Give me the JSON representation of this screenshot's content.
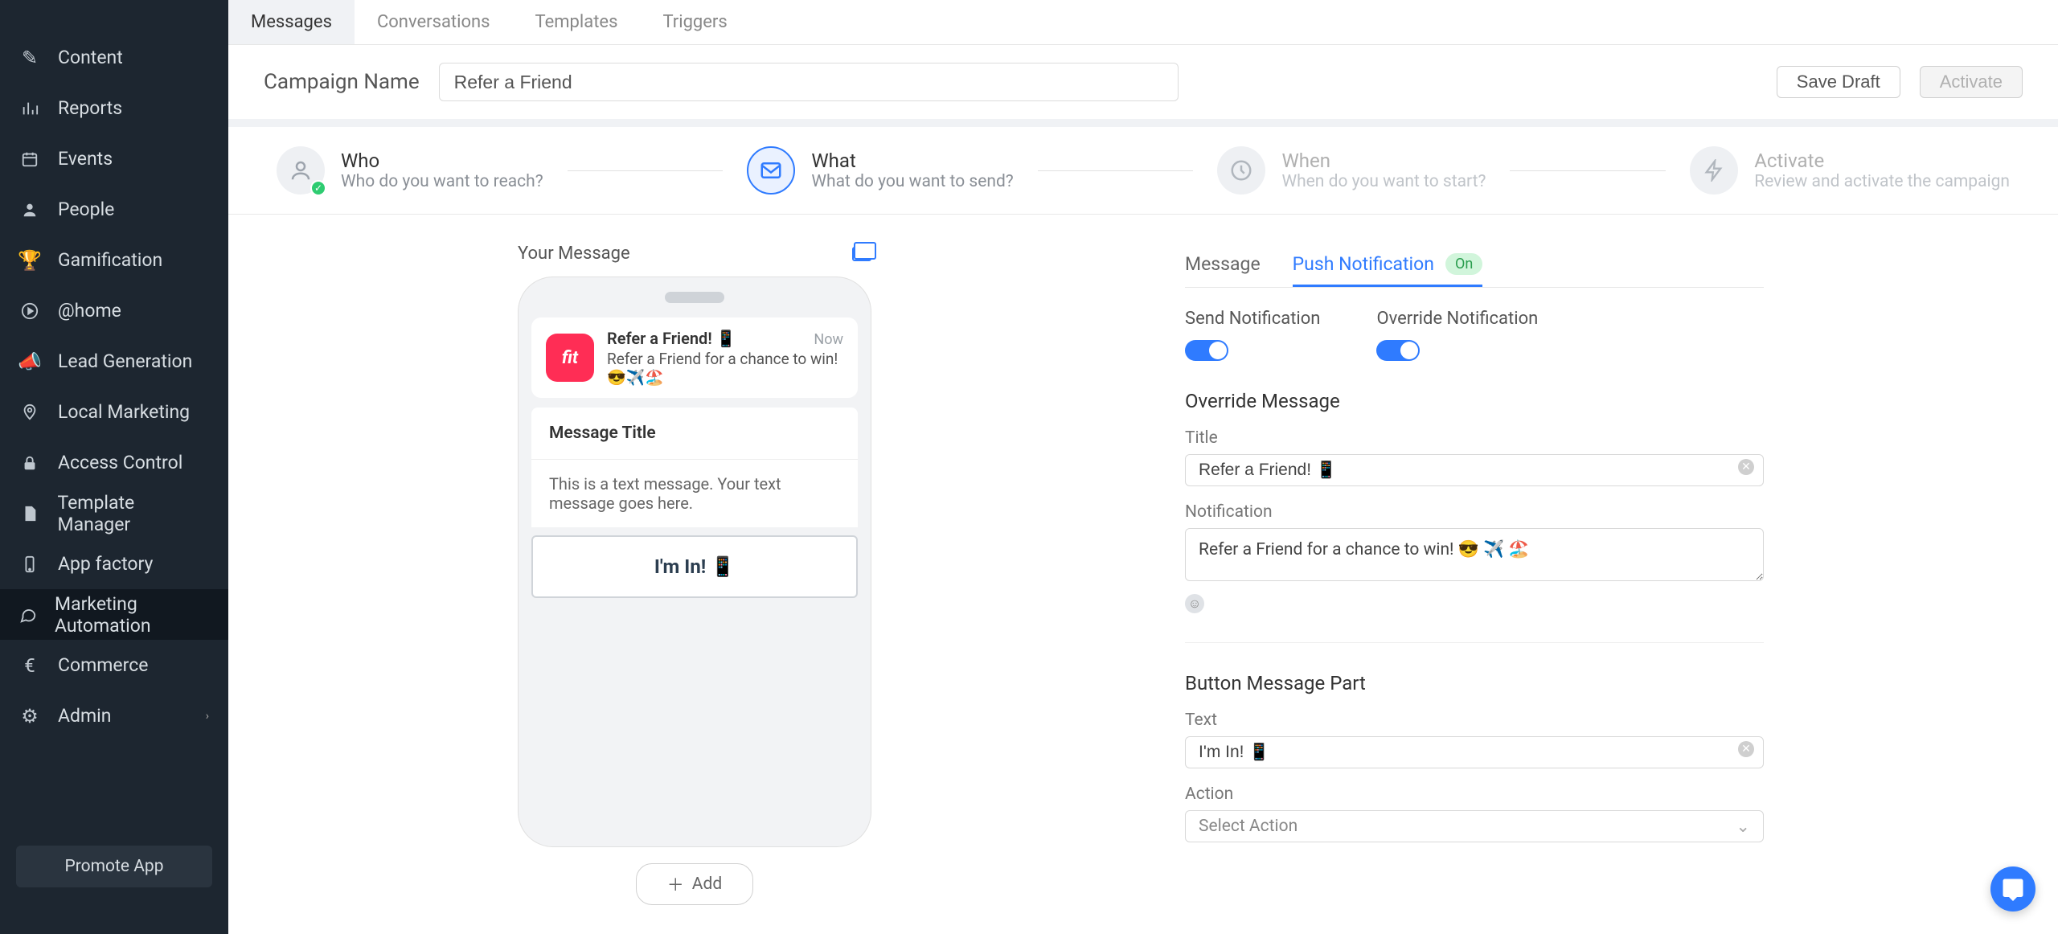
{
  "sidebar": {
    "items": [
      {
        "label": "Content",
        "icon": "pencil"
      },
      {
        "label": "Reports",
        "icon": "chart"
      },
      {
        "label": "Events",
        "icon": "calendar"
      },
      {
        "label": "People",
        "icon": "user"
      },
      {
        "label": "Gamification",
        "icon": "trophy"
      },
      {
        "label": "@home",
        "icon": "play"
      },
      {
        "label": "Lead Generation",
        "icon": "megaphone"
      },
      {
        "label": "Local Marketing",
        "icon": "pin"
      },
      {
        "label": "Access Control",
        "icon": "lock"
      },
      {
        "label": "Template Manager",
        "icon": "file"
      },
      {
        "label": "App factory",
        "icon": "phone"
      },
      {
        "label": "Marketing Automation",
        "icon": "chat"
      },
      {
        "label": "Commerce",
        "icon": "euro"
      },
      {
        "label": "Admin",
        "icon": "gear"
      }
    ],
    "promote": "Promote App"
  },
  "tabs": {
    "items": [
      "Messages",
      "Conversations",
      "Templates",
      "Triggers"
    ],
    "activeIndex": 0
  },
  "header": {
    "label": "Campaign Name",
    "value": "Refer a Friend",
    "saveDraft": "Save Draft",
    "activate": "Activate"
  },
  "stepper": {
    "who": {
      "title": "Who",
      "sub": "Who do you want to reach?"
    },
    "what": {
      "title": "What",
      "sub": "What do you want to send?"
    },
    "when": {
      "title": "When",
      "sub": "When do you want to start?"
    },
    "activate": {
      "title": "Activate",
      "sub": "Review and activate the campaign"
    }
  },
  "preview": {
    "header": "Your Message",
    "appName": "fit",
    "notifTitle": "Refer a Friend! 📱",
    "notifTime": "Now",
    "notifBody": "Refer a Friend for a chance to win! 😎✈️🏖️",
    "messageTitle": "Message Title",
    "messageBody": "This is a text message. Your text message goes here.",
    "buttonText": "I'm In! 📱",
    "addLabel": "Add"
  },
  "form": {
    "subtabs": {
      "message": "Message",
      "push": "Push Notification",
      "badge": "On"
    },
    "sendNotification": "Send Notification",
    "overrideNotification": "Override Notification",
    "overrideSection": "Override Message",
    "titleLabel": "Title",
    "titleValue": "Refer a Friend! 📱",
    "notificationLabel": "Notification",
    "notificationValue": "Refer a Friend for a chance to win! 😎 ✈️ 🏖️",
    "buttonSection": "Button Message Part",
    "textLabel": "Text",
    "textValue": "I'm In! 📱",
    "actionLabel": "Action",
    "actionPlaceholder": "Select Action"
  }
}
